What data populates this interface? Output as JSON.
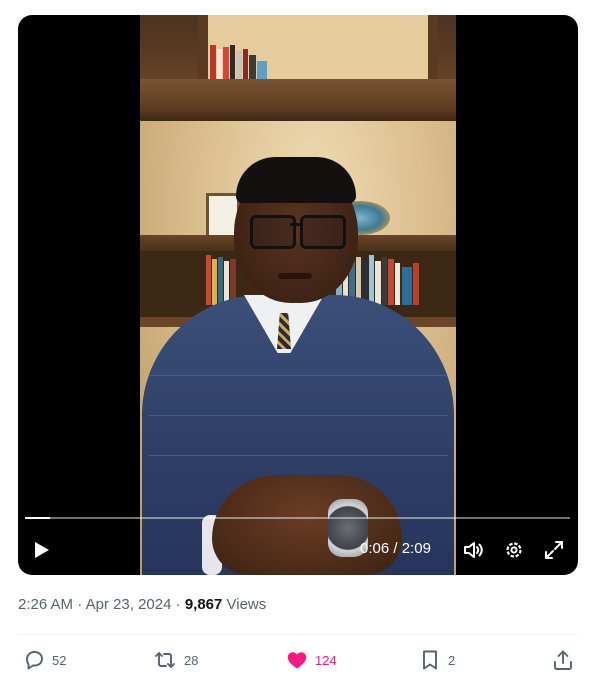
{
  "video": {
    "progress_fraction": 0.046,
    "current_time": "0:06",
    "separator": " / ",
    "duration": "2:09"
  },
  "meta": {
    "time": "2:26 AM",
    "dot1": " · ",
    "date": "Apr 23, 2024",
    "dot2": " · ",
    "views_count": "9,867",
    "views_label": " Views"
  },
  "actions": {
    "replies": "52",
    "reposts": "28",
    "likes": "124",
    "bookmarks": "2"
  },
  "colors": {
    "like_pink": "#f91880",
    "meta_gray": "#536471"
  },
  "icons": [
    "play-icon",
    "volume-icon",
    "settings-gear-icon",
    "fullscreen-icon",
    "reply-icon",
    "repost-icon",
    "heart-icon",
    "bookmark-icon",
    "share-icon"
  ]
}
